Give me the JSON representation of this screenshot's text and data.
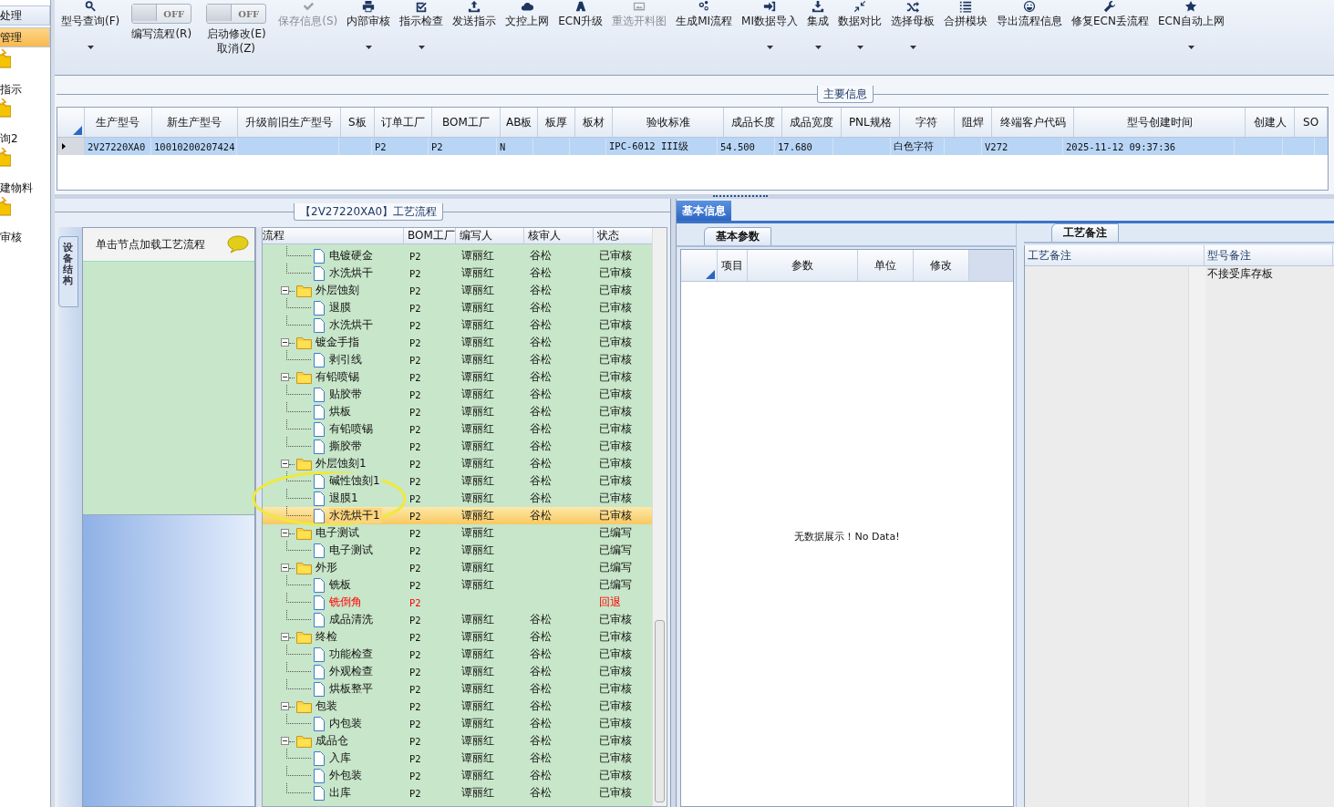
{
  "sidebar": {
    "items": [
      {
        "label": "处理",
        "kind": "text",
        "selected": false
      },
      {
        "label": "管理",
        "kind": "text",
        "selected": true
      },
      {
        "label": "指示",
        "kind": "icon",
        "selected": false
      },
      {
        "label": "询2",
        "kind": "icon",
        "selected": false
      },
      {
        "label": "建物料",
        "kind": "icon",
        "selected": false
      },
      {
        "label": "审核",
        "kind": "icon",
        "selected": false
      }
    ]
  },
  "toolbar": {
    "items": [
      {
        "kind": "button",
        "label": "型号查询(F)",
        "dropdown": true,
        "disabled": false
      },
      {
        "kind": "toggle",
        "label": "编写流程(R)",
        "switch_text": "OFF",
        "on": false
      },
      {
        "kind": "toggle",
        "label": "启动修改(E)\n取消(Z)",
        "switch_text": "OFF",
        "on": false
      },
      {
        "kind": "button",
        "label": "保存信息(S)",
        "dropdown": false,
        "disabled": true
      },
      {
        "kind": "button",
        "label": "内部审核",
        "dropdown": true,
        "disabled": false
      },
      {
        "kind": "button",
        "label": "指示检查",
        "dropdown": true,
        "disabled": false
      },
      {
        "kind": "button",
        "label": "发送指示",
        "dropdown": false,
        "disabled": false
      },
      {
        "kind": "button",
        "label": "文控上网",
        "dropdown": false,
        "disabled": false
      },
      {
        "kind": "button",
        "label": "ECN升级",
        "dropdown": false,
        "disabled": false
      },
      {
        "kind": "button",
        "label": "重选开料图",
        "dropdown": false,
        "disabled": true
      },
      {
        "kind": "button",
        "label": "生成MI流程",
        "dropdown": false,
        "disabled": false
      },
      {
        "kind": "button",
        "label": "MI数据导入",
        "dropdown": true,
        "disabled": false
      },
      {
        "kind": "button",
        "label": "集成",
        "dropdown": true,
        "disabled": false
      },
      {
        "kind": "button",
        "label": "数据对比",
        "dropdown": true,
        "disabled": false
      },
      {
        "kind": "button",
        "label": "选择母板",
        "dropdown": true,
        "disabled": false
      },
      {
        "kind": "button",
        "label": "合拼模块",
        "dropdown": false,
        "disabled": false
      },
      {
        "kind": "button",
        "label": "导出流程信息",
        "dropdown": false,
        "disabled": false
      },
      {
        "kind": "button",
        "label": "修复ECN丢流程",
        "dropdown": false,
        "disabled": false
      },
      {
        "kind": "button",
        "label": "ECN自动上网",
        "dropdown": true,
        "disabled": false
      }
    ]
  },
  "main_info": {
    "title": "主要信息",
    "columns": [
      "生产型号",
      "新生产型号",
      "升级前旧生产型号",
      "S板",
      "订单工厂",
      "BOM工厂",
      "AB板",
      "板厚",
      "板材",
      "验收标准",
      "成品长度",
      "成品宽度",
      "PNL规格",
      "字符",
      "阻焊",
      "终端客户代码",
      "型号创建时间",
      "创建人",
      "SO"
    ],
    "rows": [
      {
        "selected": true,
        "cells": [
          "2V27220XA0",
          "10010200207424",
          null,
          null,
          "P2",
          "P2",
          "N",
          null,
          null,
          "IPC-6012 III级",
          "54.500",
          "17.680",
          null,
          "白色字符",
          null,
          "V272",
          "2025-11-12 09:37:36",
          null,
          null
        ]
      }
    ]
  },
  "process_panel": {
    "title": "【2V27220XA0】工艺流程",
    "side_tab": "设备结构",
    "hint": "单击节点加载工艺流程",
    "tree": {
      "columns": [
        "流程",
        "BOM工厂",
        "编写人",
        "核审人",
        "状态"
      ],
      "rows": [
        {
          "children": [
            {
              "label": "电镀硬金",
              "bom": "P2",
              "writer": "谭丽红",
              "reviewer": "谷松",
              "status": "已审核",
              "selected": false,
              "rejected": false
            },
            {
              "label": "水洗烘干",
              "bom": "P2",
              "writer": "谭丽红",
              "reviewer": "谷松",
              "status": "已审核",
              "selected": false,
              "rejected": false
            }
          ]
        },
        {
          "label": "外层蚀刻",
          "bom": "P2",
          "writer": "谭丽红",
          "reviewer": "谷松",
          "status": "已审核",
          "selected": false,
          "rejected": false,
          "expanded": true,
          "children": [
            {
              "label": "退膜",
              "bom": "P2",
              "writer": "谭丽红",
              "reviewer": "谷松",
              "status": "已审核",
              "selected": false,
              "rejected": false
            },
            {
              "label": "水洗烘干",
              "bom": "P2",
              "writer": "谭丽红",
              "reviewer": "谷松",
              "status": "已审核",
              "selected": false,
              "rejected": false
            }
          ]
        },
        {
          "label": "镀金手指",
          "bom": "P2",
          "writer": "谭丽红",
          "reviewer": "谷松",
          "status": "已审核",
          "selected": false,
          "rejected": false,
          "expanded": true,
          "children": [
            {
              "label": "剥引线",
              "bom": "P2",
              "writer": "谭丽红",
              "reviewer": "谷松",
              "status": "已审核",
              "selected": false,
              "rejected": false
            }
          ]
        },
        {
          "label": "有铅喷锡",
          "bom": "P2",
          "writer": "谭丽红",
          "reviewer": "谷松",
          "status": "已审核",
          "selected": false,
          "rejected": false,
          "expanded": true,
          "children": [
            {
              "label": "贴胶带",
              "bom": "P2",
              "writer": "谭丽红",
              "reviewer": "谷松",
              "status": "已审核",
              "selected": false,
              "rejected": false
            },
            {
              "label": "烘板",
              "bom": "P2",
              "writer": "谭丽红",
              "reviewer": "谷松",
              "status": "已审核",
              "selected": false,
              "rejected": false
            },
            {
              "label": "有铅喷锡",
              "bom": "P2",
              "writer": "谭丽红",
              "reviewer": "谷松",
              "status": "已审核",
              "selected": false,
              "rejected": false
            },
            {
              "label": "撕胶带",
              "bom": "P2",
              "writer": "谭丽红",
              "reviewer": "谷松",
              "status": "已审核",
              "selected": false,
              "rejected": false
            }
          ]
        },
        {
          "label": "外层蚀刻1",
          "bom": "P2",
          "writer": "谭丽红",
          "reviewer": "谷松",
          "status": "已审核",
          "selected": false,
          "rejected": false,
          "expanded": true,
          "children": [
            {
              "label": "碱性蚀刻1",
              "bom": "P2",
              "writer": "谭丽红",
              "reviewer": "谷松",
              "status": "已审核",
              "selected": false,
              "rejected": false
            },
            {
              "label": "退膜1",
              "bom": "P2",
              "writer": "谭丽红",
              "reviewer": "谷松",
              "status": "已审核",
              "selected": false,
              "rejected": false
            },
            {
              "label": "水洗烘干1",
              "bom": "P2",
              "writer": "谭丽红",
              "reviewer": "谷松",
              "status": "已审核",
              "selected": true,
              "rejected": false
            }
          ]
        },
        {
          "label": "电子测试",
          "bom": "P2",
          "writer": "谭丽红",
          "status": "已编写",
          "selected": false,
          "rejected": false,
          "expanded": true,
          "children": [
            {
              "label": "电子测试",
              "bom": "P2",
              "writer": "谭丽红",
              "status": "已编写",
              "selected": false,
              "rejected": false
            }
          ]
        },
        {
          "label": "外形",
          "bom": "P2",
          "writer": "谭丽红",
          "status": "已编写",
          "selected": false,
          "rejected": false,
          "expanded": true,
          "children": [
            {
              "label": "铣板",
              "bom": "P2",
              "writer": "谭丽红",
              "status": "已编写",
              "selected": false,
              "rejected": false
            },
            {
              "label": "铣倒角",
              "bom": "P2",
              "status": "回退",
              "selected": false,
              "rejected": true
            },
            {
              "label": "成品清洗",
              "bom": "P2",
              "writer": "谭丽红",
              "reviewer": "谷松",
              "status": "已审核",
              "selected": false,
              "rejected": false
            }
          ]
        },
        {
          "label": "终检",
          "bom": "P2",
          "writer": "谭丽红",
          "reviewer": "谷松",
          "status": "已审核",
          "selected": false,
          "rejected": false,
          "expanded": true,
          "children": [
            {
              "label": "功能检查",
              "bom": "P2",
              "writer": "谭丽红",
              "reviewer": "谷松",
              "status": "已审核",
              "selected": false,
              "rejected": false
            },
            {
              "label": "外观检查",
              "bom": "P2",
              "writer": "谭丽红",
              "reviewer": "谷松",
              "status": "已审核",
              "selected": false,
              "rejected": false
            },
            {
              "label": "烘板整平",
              "bom": "P2",
              "writer": "谭丽红",
              "reviewer": "谷松",
              "status": "已审核",
              "selected": false,
              "rejected": false
            }
          ]
        },
        {
          "label": "包装",
          "bom": "P2",
          "writer": "谭丽红",
          "reviewer": "谷松",
          "status": "已审核",
          "selected": false,
          "rejected": false,
          "expanded": true,
          "children": [
            {
              "label": "内包装",
              "bom": "P2",
              "writer": "谭丽红",
              "reviewer": "谷松",
              "status": "已审核",
              "selected": false,
              "rejected": false
            }
          ]
        },
        {
          "label": "成品仓",
          "bom": "P2",
          "writer": "谭丽红",
          "reviewer": "谷松",
          "status": "已审核",
          "selected": false,
          "rejected": false,
          "expanded": true,
          "children": [
            {
              "label": "入库",
              "bom": "P2",
              "writer": "谭丽红",
              "reviewer": "谷松",
              "status": "已审核",
              "selected": false,
              "rejected": false
            },
            {
              "label": "外包装",
              "bom": "P2",
              "writer": "谭丽红",
              "reviewer": "谷松",
              "status": "已审核",
              "selected": false,
              "rejected": false
            },
            {
              "label": "出库",
              "bom": "P2",
              "writer": "谭丽红",
              "reviewer": "谷松",
              "status": "已审核",
              "selected": false,
              "rejected": false
            }
          ]
        }
      ]
    }
  },
  "details": {
    "tabs": [
      {
        "label": "基本信息",
        "selected": true
      }
    ],
    "params": {
      "tab": "基本参数",
      "columns": [
        "项目",
        "参数",
        "单位",
        "修改"
      ],
      "empty_text": "无数据展示！No Data!"
    },
    "notes": {
      "tab": "工艺备注",
      "columns": [
        "工艺备注",
        "型号备注"
      ],
      "rows": [
        {
          "cells": [
            null,
            "不接受库存板"
          ]
        }
      ]
    }
  }
}
